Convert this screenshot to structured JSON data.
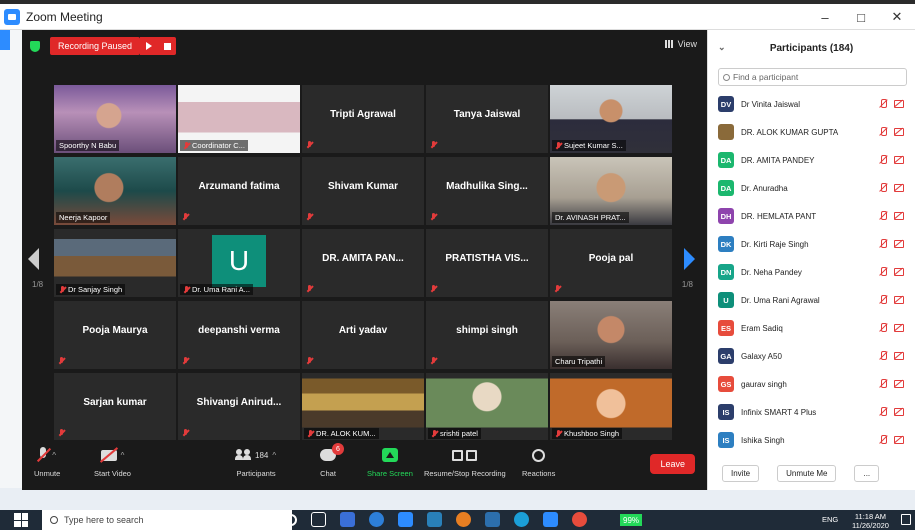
{
  "window": {
    "title": "Zoom Meeting",
    "controls": [
      "–",
      "□",
      "✕"
    ]
  },
  "recording": {
    "status": "Recording Paused"
  },
  "view_label": "View",
  "pagination": {
    "left": "1/8",
    "right": "1/8"
  },
  "tiles": [
    {
      "label": "Spoorthy N Babu",
      "video": true,
      "muted": false,
      "photo": "pink"
    },
    {
      "label": "Coordinator C...",
      "video": true,
      "muted": true,
      "photo": "building"
    },
    {
      "center": "Tripti Agrawal",
      "video": false,
      "muted": true
    },
    {
      "center": "Tanya Jaiswal",
      "video": false,
      "muted": true
    },
    {
      "label": "Sujeet Kumar S...",
      "video": true,
      "muted": true,
      "photo": "office"
    },
    {
      "label": "Neerja Kapoor",
      "video": true,
      "muted": false,
      "photo": "neerja"
    },
    {
      "center": "Arzumand fatima",
      "video": false,
      "muted": true
    },
    {
      "center": "Shivam Kumar",
      "video": false,
      "muted": true
    },
    {
      "center": "Madhulika Sing...",
      "video": false,
      "muted": true
    },
    {
      "label": "Dr. AVINASH PRAT...",
      "video": true,
      "muted": false,
      "photo": "avinash"
    },
    {
      "label": "Dr Sanjay Singh",
      "video": true,
      "muted": true,
      "photo": "sanjay"
    },
    {
      "label": "Dr. Uma Rani A...",
      "video": false,
      "muted": true,
      "avatar": "U"
    },
    {
      "center": "DR. AMITA PAN...",
      "video": false,
      "muted": true
    },
    {
      "center": "PRATISTHA VIS...",
      "video": false,
      "muted": true
    },
    {
      "center": "Pooja pal",
      "video": false,
      "muted": true
    },
    {
      "center": "Pooja Maurya",
      "video": false,
      "muted": true
    },
    {
      "center": "deepanshi verma",
      "video": false,
      "muted": true
    },
    {
      "center": "Arti yadav",
      "video": false,
      "muted": true
    },
    {
      "center": "shimpi singh",
      "video": false,
      "muted": true
    },
    {
      "label": "Charu Tripathi",
      "video": true,
      "muted": false,
      "photo": "charu",
      "active": true
    },
    {
      "center": "Sarjan kumar",
      "video": false,
      "muted": true
    },
    {
      "center": "Shivangi Anirud...",
      "video": false,
      "muted": true
    },
    {
      "label": "DR. ALOK KUM...",
      "video": true,
      "muted": true,
      "photo": "alok"
    },
    {
      "label": "srishti patel",
      "video": true,
      "muted": true,
      "photo": "srishti"
    },
    {
      "label": "Khushboo Singh",
      "video": true,
      "muted": true,
      "photo": "khushboo"
    }
  ],
  "toolbar": {
    "unmute": "Unmute",
    "start_video": "Start Video",
    "participants": "Participants",
    "participants_count": "184",
    "chat": "Chat",
    "chat_badge": "6",
    "share_screen": "Share Screen",
    "record": "Resume/Stop Recording",
    "reactions": "Reactions",
    "leave": "Leave"
  },
  "panel": {
    "title": "Participants (184)",
    "search_placeholder": "Find a participant",
    "participants": [
      {
        "initials": "DV",
        "name": "Dr Vinita Jaiswal",
        "color": "#2c3e6b"
      },
      {
        "initials": "",
        "name": "DR. ALOK KUMAR GUPTA",
        "color": "#8a6a3a"
      },
      {
        "initials": "DA",
        "name": "DR. AMITA PANDEY",
        "color": "#1bb76e"
      },
      {
        "initials": "DA",
        "name": "Dr. Anuradha",
        "color": "#1bb76e"
      },
      {
        "initials": "DH",
        "name": "DR. HEMLATA PANT",
        "color": "#8e44ad"
      },
      {
        "initials": "DK",
        "name": "Dr. Kirti Raje Singh",
        "color": "#2d7fc1"
      },
      {
        "initials": "DN",
        "name": "Dr. Neha Pandey",
        "color": "#17a589"
      },
      {
        "initials": "U",
        "name": "Dr. Uma Rani Agrawal",
        "color": "#0e8f7a"
      },
      {
        "initials": "ES",
        "name": "Eram Sadiq",
        "color": "#e74c3c"
      },
      {
        "initials": "GA",
        "name": "Galaxy A50",
        "color": "#2c3e6b"
      },
      {
        "initials": "GS",
        "name": "gaurav singh",
        "color": "#e74c3c"
      },
      {
        "initials": "IS",
        "name": "Infinix SMART 4 Plus",
        "color": "#2c3e6b"
      },
      {
        "initials": "IS",
        "name": "Ishika Singh",
        "color": "#2d7fc1"
      }
    ],
    "invite": "Invite",
    "unmute_me": "Unmute Me",
    "more": "..."
  },
  "taskbar": {
    "search_placeholder": "Type here to search",
    "battery": "99%",
    "lang": "ENG",
    "time": "11:18 AM",
    "date": "11/26/2020"
  }
}
